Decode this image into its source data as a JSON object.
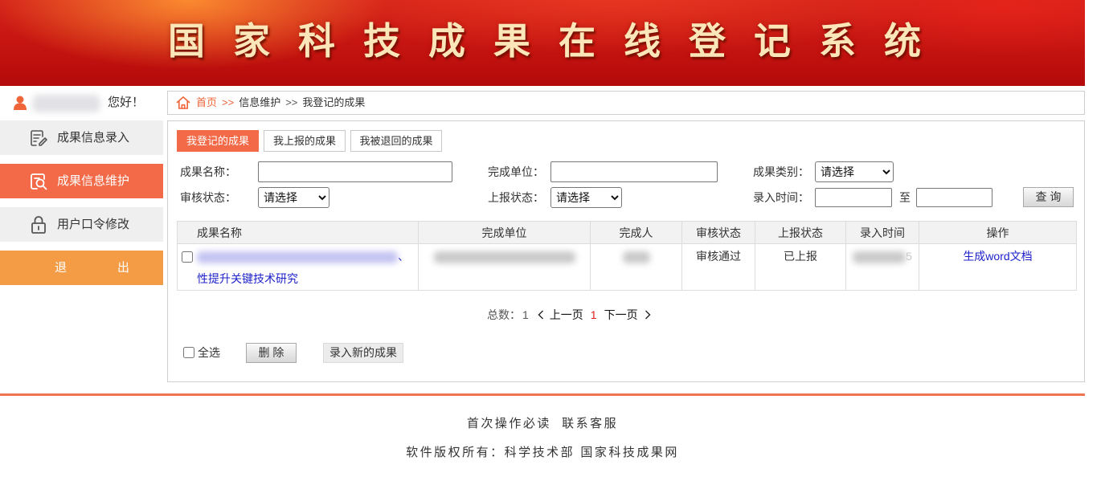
{
  "header": {
    "title": "国家科技成果在线登记系统"
  },
  "user": {
    "greeting": "您好！",
    "icon": "user-icon"
  },
  "sidebar": {
    "items": [
      {
        "label": "成果信息录入",
        "icon": "edit-form-icon",
        "active": false
      },
      {
        "label": "成果信息维护",
        "icon": "search-document-icon",
        "active": true
      },
      {
        "label": "用户口令修改",
        "icon": "lock-icon",
        "active": false
      }
    ],
    "logout": {
      "label": "退出"
    }
  },
  "breadcrumb": {
    "icon": "home-icon",
    "home": "首页",
    "separator": ">>",
    "items": [
      "信息维护",
      "我登记的成果"
    ]
  },
  "tabs": [
    {
      "label": "我登记的成果",
      "active": true
    },
    {
      "label": "我上报的成果",
      "active": false
    },
    {
      "label": "我被退回的成果",
      "active": false
    }
  ],
  "filters": {
    "name": {
      "label": "成果名称：",
      "value": ""
    },
    "unit": {
      "label": "完成单位：",
      "value": ""
    },
    "category": {
      "label": "成果类别：",
      "selected": "请选择"
    },
    "audit_status": {
      "label": "审核状态：",
      "selected": "请选择"
    },
    "report_status": {
      "label": "上报状态：",
      "selected": "请选择"
    },
    "entry_time": {
      "label": "录入时间：",
      "from": "",
      "separator": "至",
      "to": ""
    },
    "query_button": "查 询"
  },
  "table": {
    "columns": [
      "成果名称",
      "完成单位",
      "完成人",
      "审核状态",
      "上报状态",
      "录入时间",
      "操作"
    ],
    "rows": [
      {
        "name_line1_end": "、",
        "name_line2": "性提升关键技术研究",
        "audit_status": "审核通过",
        "report_status": "已上报",
        "entry_time_tail": "5",
        "action": "生成word文档"
      }
    ]
  },
  "pagination": {
    "total_label": "总数：",
    "total": "1",
    "prev": "上一页",
    "current": "1",
    "next": "下一页"
  },
  "actions": {
    "select_all": "全选",
    "delete": "删 除",
    "add_new": "录入新的成果"
  },
  "footer": {
    "links": [
      "首次操作必读",
      "联系客服"
    ],
    "copyright": "软件版权所有：科学技术部 国家科技成果网"
  },
  "colors": {
    "header_red": "#c51410",
    "accent": "#f26a47",
    "logout": "#f39b45",
    "link": "#1e22c8",
    "current_page": "#e02020",
    "footer_line": "#f07352"
  }
}
